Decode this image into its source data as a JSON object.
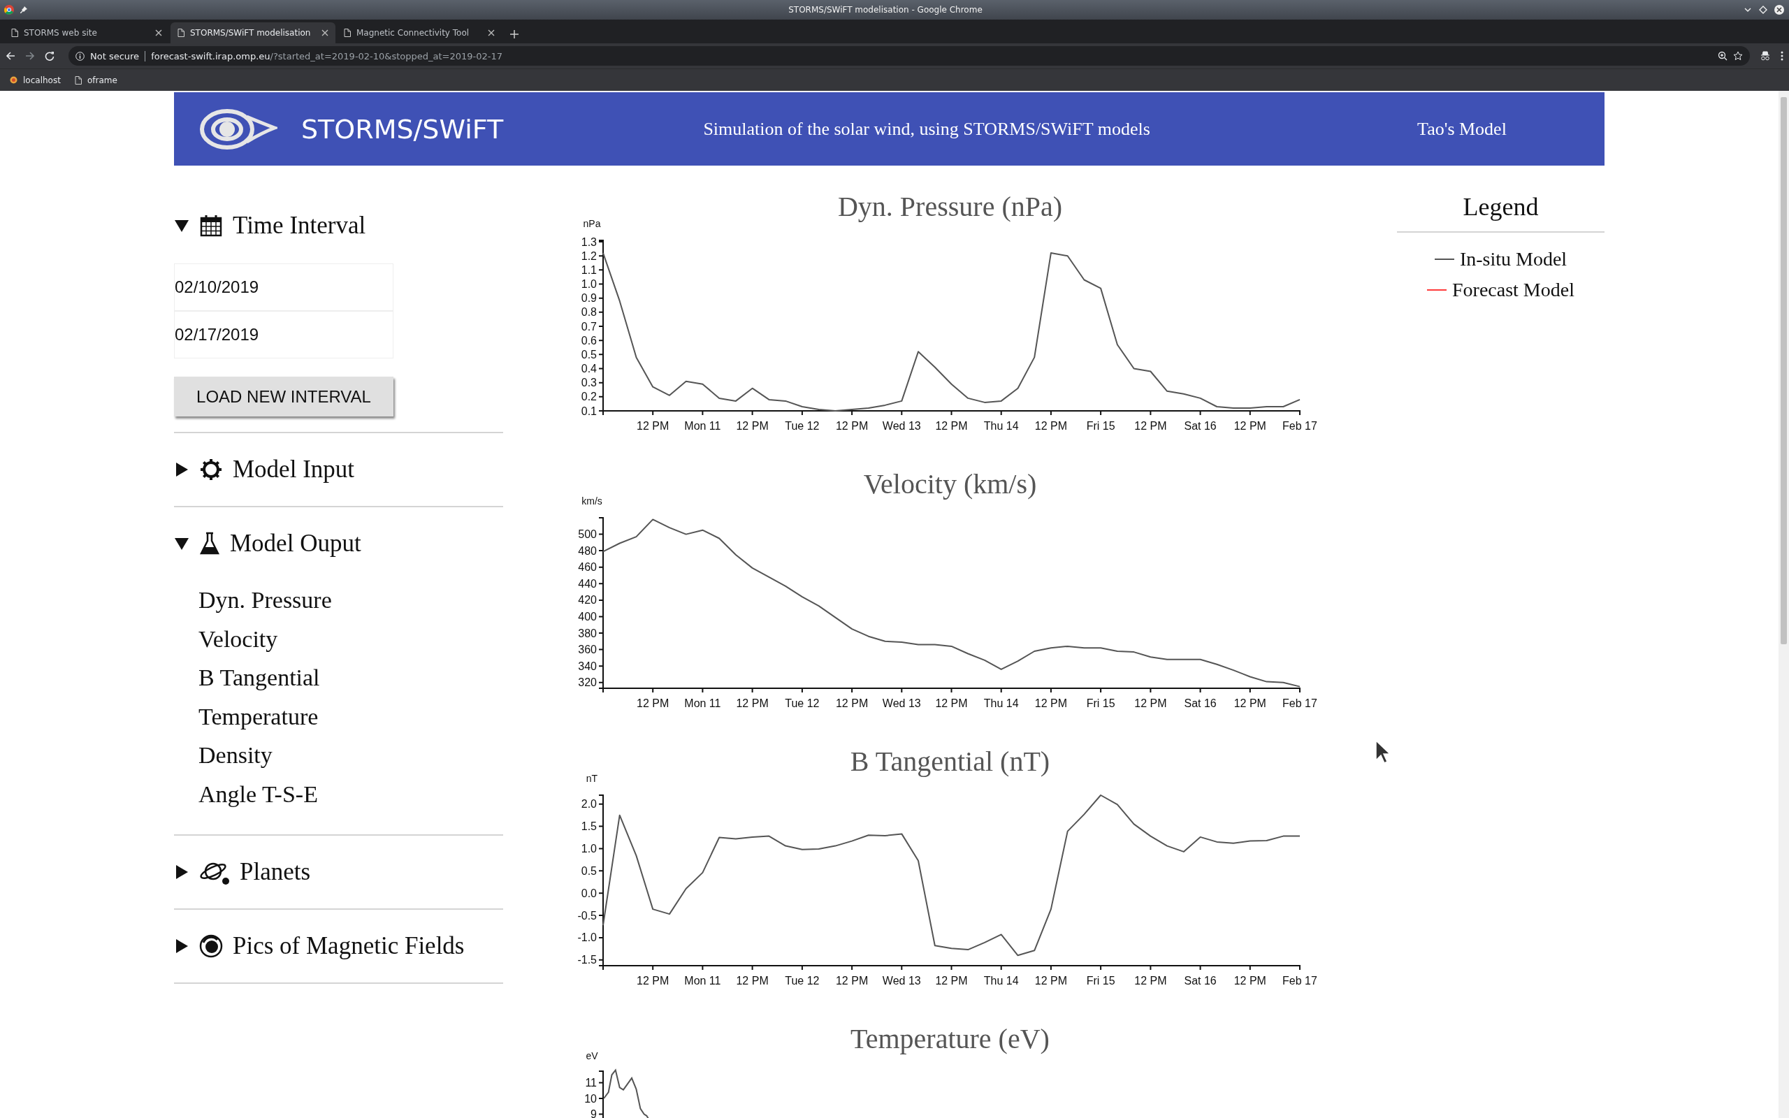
{
  "window": {
    "title": "STORMS/SWiFT modelisation - Google Chrome"
  },
  "tabs": [
    {
      "label": "STORMS web site",
      "selected": false
    },
    {
      "label": "STORMS/SWiFT modelisation",
      "selected": true
    },
    {
      "label": "Magnetic Connectivity Tool",
      "selected": false
    }
  ],
  "address_bar": {
    "security": "Not secure",
    "host": "forecast-swift.irap.omp.eu",
    "path": "/?started_at=2019-02-10&stopped_at=2019-02-17"
  },
  "bookmarks": [
    {
      "label": "localhost"
    },
    {
      "label": "oframe"
    }
  ],
  "header": {
    "logo_text": "STORMS/SWiFT",
    "subtitle": "Simulation of the solar wind, using STORMS/SWiFT models",
    "model": "Tao's Model"
  },
  "sidebar": {
    "sections": [
      {
        "title": "Time Interval",
        "expanded": true,
        "fields": [
          {
            "value": "02/10/2019"
          },
          {
            "value": "02/17/2019"
          }
        ],
        "button": "LOAD NEW INTERVAL"
      },
      {
        "title": "Model Input",
        "expanded": false
      },
      {
        "title": "Model Ouput",
        "expanded": true,
        "items": [
          "Dyn. Pressure",
          "Velocity",
          "B Tangential",
          "Temperature",
          "Density",
          "Angle T-S-E"
        ]
      },
      {
        "title": "Planets",
        "expanded": false
      },
      {
        "title": "Pics of Magnetic Fields",
        "expanded": false
      }
    ]
  },
  "charts": [
    {
      "chart_data": {
        "type": "line",
        "title": "Dyn. Pressure (nPa)",
        "ylabel": "nPa",
        "ylim": [
          0.1,
          1.31
        ],
        "categories": [
          null,
          null,
          null,
          "12 PM",
          null,
          null,
          "Mon 11",
          null,
          null,
          "12 PM",
          null,
          null,
          "Tue 12",
          null,
          null,
          "12 PM",
          null,
          null,
          "Wed 13",
          null,
          null,
          "12 PM",
          null,
          null,
          "Thu 14",
          null,
          null,
          "12 PM",
          null,
          null,
          "Fri 15",
          null,
          null,
          "12 PM",
          null,
          null,
          "Sat 16",
          null,
          null,
          "12 PM",
          null,
          null,
          "Feb 17"
        ],
        "yticks": [
          {
            "value": 0.1,
            "label": "0.1"
          },
          {
            "value": 0.2,
            "label": "0.2"
          },
          {
            "value": 0.3,
            "label": "0.3"
          },
          {
            "value": 0.4,
            "label": "0.4"
          },
          {
            "value": 0.5,
            "label": "0.5"
          },
          {
            "value": 0.6,
            "label": "0.6"
          },
          {
            "value": 0.7,
            "label": "0.7"
          },
          {
            "value": 0.8,
            "label": "0.8"
          },
          {
            "value": 0.9,
            "label": "0.9"
          },
          {
            "value": 1,
            "label": "1.0"
          },
          {
            "value": 1.1,
            "label": "1.1"
          },
          {
            "value": 1.2,
            "label": "1.2"
          },
          {
            "value": 1.3,
            "label": "1.3"
          }
        ],
        "series": [
          {
            "color": "#555555",
            "values": [
              1.22,
              0.88,
              0.48,
              0.27,
              0.21,
              0.31,
              0.29,
              0.19,
              0.17,
              0.26,
              0.18,
              0.17,
              0.13,
              0.11,
              0.1,
              0.11,
              0.12,
              0.14,
              0.17,
              0.52,
              0.41,
              0.29,
              0.19,
              0.16,
              0.17,
              0.26,
              0.48,
              1.22,
              1.2,
              1.03,
              0.97,
              0.57,
              0.4,
              0.38,
              0.24,
              0.22,
              0.19,
              0.13,
              0.12,
              0.12,
              0.13,
              0.13,
              0.18
            ]
          }
        ]
      }
    },
    {
      "chart_data": {
        "type": "line",
        "title": "Velocity (km/s)",
        "ylabel": "km/s",
        "ylim": [
          313,
          520
        ],
        "categories": [
          null,
          null,
          null,
          "12 PM",
          null,
          null,
          "Mon 11",
          null,
          null,
          "12 PM",
          null,
          null,
          "Tue 12",
          null,
          null,
          "12 PM",
          null,
          null,
          "Wed 13",
          null,
          null,
          "12 PM",
          null,
          null,
          "Thu 14",
          null,
          null,
          "12 PM",
          null,
          null,
          "Fri 15",
          null,
          null,
          "12 PM",
          null,
          null,
          "Sat 16",
          null,
          null,
          "12 PM",
          null,
          null,
          "Feb 17"
        ],
        "yticks": [
          320,
          340,
          360,
          380,
          400,
          420,
          440,
          460,
          480,
          500
        ],
        "series": [
          {
            "color": "#555555",
            "values": [
              479,
              489,
              497,
              518,
              508,
              500,
              505,
              495,
              475,
              459,
              448,
              437,
              424,
              413,
              399,
              385,
              376,
              370,
              369,
              366,
              366,
              364,
              355,
              347,
              336,
              346,
              358,
              362,
              364,
              362,
              362,
              358,
              357,
              351,
              348,
              348,
              348,
              342,
              335,
              327,
              321,
              320,
              315
            ]
          }
        ]
      }
    },
    {
      "chart_data": {
        "type": "line",
        "title": "B Tangential (nT)",
        "ylabel": "nT",
        "ylim": [
          -1.63,
          2.2
        ],
        "categories": [
          null,
          null,
          null,
          "12 PM",
          null,
          null,
          "Mon 11",
          null,
          null,
          "12 PM",
          null,
          null,
          "Tue 12",
          null,
          null,
          "12 PM",
          null,
          null,
          "Wed 13",
          null,
          null,
          "12 PM",
          null,
          null,
          "Thu 14",
          null,
          null,
          "12 PM",
          null,
          null,
          "Fri 15",
          null,
          null,
          "12 PM",
          null,
          null,
          "Sat 16",
          null,
          null,
          "12 PM",
          null,
          null,
          "Feb 17"
        ],
        "yticks": [
          {
            "value": -1.5,
            "label": "-1.5"
          },
          {
            "value": -1,
            "label": "-1.0"
          },
          {
            "value": -0.5,
            "label": "-0.5"
          },
          {
            "value": 0,
            "label": "0.0"
          },
          {
            "value": 0.5,
            "label": "0.5"
          },
          {
            "value": 1,
            "label": "1.0"
          },
          {
            "value": 1.5,
            "label": "1.5"
          },
          {
            "value": 2,
            "label": "2.0"
          }
        ],
        "series": [
          {
            "color": "#555555",
            "values": [
              -0.72,
              1.75,
              0.84,
              -0.36,
              -0.47,
              0.1,
              0.46,
              1.25,
              1.22,
              1.26,
              1.28,
              1.06,
              0.98,
              0.99,
              1.06,
              1.17,
              1.3,
              1.29,
              1.33,
              0.73,
              -1.18,
              -1.24,
              -1.27,
              -1.11,
              -0.93,
              -1.4,
              -1.29,
              -0.36,
              1.39,
              1.77,
              2.2,
              1.99,
              1.55,
              1.28,
              1.06,
              0.93,
              1.26,
              1.15,
              1.12,
              1.17,
              1.18,
              1.28,
              1.28
            ]
          }
        ]
      }
    },
    {
      "kind": "picture",
      "title": "Temperature (eV)",
      "ylabel": "eV",
      "tick_labels": [
        "11",
        "10",
        "9"
      ]
    }
  ],
  "legend": {
    "title": "Legend",
    "items": [
      {
        "label": "In-situ Model",
        "color": "#555555"
      },
      {
        "label": "Forecast Model",
        "color": "#ff3b3b"
      }
    ]
  }
}
